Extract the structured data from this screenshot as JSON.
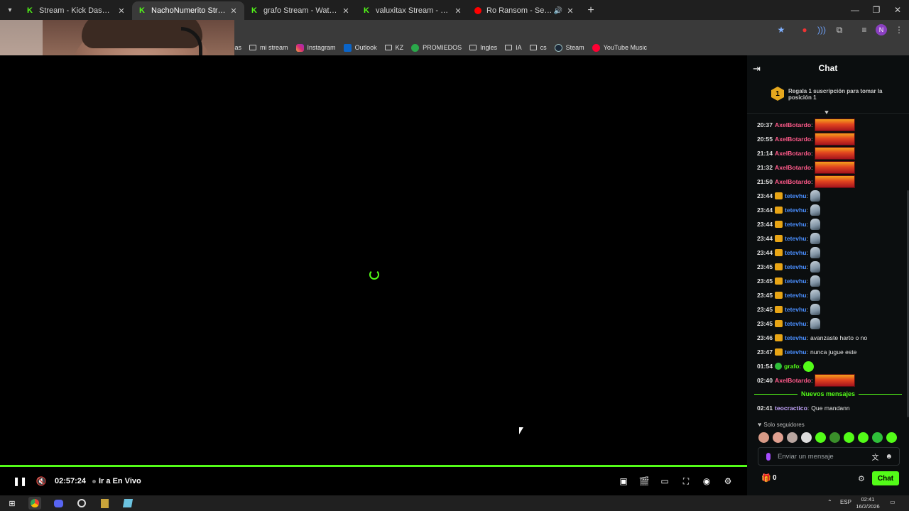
{
  "tabs": [
    {
      "label": "Stream - Kick Dashboard",
      "favicon": "kick-icon",
      "active": false
    },
    {
      "label": "NachoNumerito Stream - Watch",
      "favicon": "kick-icon",
      "active": true
    },
    {
      "label": "grafo Stream - Watch Live on K",
      "favicon": "kick-icon",
      "active": false
    },
    {
      "label": "valuxitax Stream - Watch Live o",
      "favicon": "kick-icon",
      "active": false
    },
    {
      "label": "Ro Ransom - See Me Fall ft",
      "favicon": "youtube-icon",
      "active": false
    }
  ],
  "bookmarks": [
    {
      "label": "cas",
      "icon": "folder-icon"
    },
    {
      "label": "mi stream",
      "icon": "folder-icon"
    },
    {
      "label": "Instagram",
      "icon": "instagram-icon"
    },
    {
      "label": "Outlook",
      "icon": "outlook-icon"
    },
    {
      "label": "KZ",
      "icon": "folder-icon"
    },
    {
      "label": "PROMIEDOS",
      "icon": "promiedos-icon"
    },
    {
      "label": "Ingles",
      "icon": "folder-icon"
    },
    {
      "label": "IA",
      "icon": "folder-icon"
    },
    {
      "label": "cs",
      "icon": "folder-icon"
    },
    {
      "label": "Steam",
      "icon": "steam-icon"
    },
    {
      "label": "YouTube Music",
      "icon": "youtube-music-icon"
    }
  ],
  "player": {
    "time": "02:57:24",
    "live_label": "Ir a En Vivo"
  },
  "chat": {
    "title": "Chat",
    "pinned_rank": "1",
    "pinned_text": "Regala 1 suscripción para tomar la posición 1",
    "messages": [
      {
        "time": "20:37",
        "user": "AxelBotardo",
        "color": "#ff5a8a",
        "badge": "none",
        "content": "",
        "emote": "fire"
      },
      {
        "time": "20:55",
        "user": "AxelBotardo",
        "color": "#ff5a8a",
        "badge": "none",
        "content": "",
        "emote": "fire"
      },
      {
        "time": "21:14",
        "user": "AxelBotardo",
        "color": "#ff5a8a",
        "badge": "none",
        "content": "",
        "emote": "fire"
      },
      {
        "time": "21:32",
        "user": "AxelBotardo",
        "color": "#ff5a8a",
        "badge": "none",
        "content": "",
        "emote": "fire"
      },
      {
        "time": "21:50",
        "user": "AxelBotardo",
        "color": "#ff5a8a",
        "badge": "none",
        "content": "",
        "emote": "fire"
      },
      {
        "time": "23:44",
        "user": "tetevhu",
        "color": "#4a8fff",
        "badge": "crown",
        "content": "",
        "emote": "bird"
      },
      {
        "time": "23:44",
        "user": "tetevhu",
        "color": "#4a8fff",
        "badge": "crown",
        "content": "",
        "emote": "bird"
      },
      {
        "time": "23:44",
        "user": "tetevhu",
        "color": "#4a8fff",
        "badge": "crown",
        "content": "",
        "emote": "bird"
      },
      {
        "time": "23:44",
        "user": "tetevhu",
        "color": "#4a8fff",
        "badge": "crown",
        "content": "",
        "emote": "bird"
      },
      {
        "time": "23:44",
        "user": "tetevhu",
        "color": "#4a8fff",
        "badge": "crown",
        "content": "",
        "emote": "bird"
      },
      {
        "time": "23:45",
        "user": "tetevhu",
        "color": "#4a8fff",
        "badge": "crown",
        "content": "",
        "emote": "bird"
      },
      {
        "time": "23:45",
        "user": "tetevhu",
        "color": "#4a8fff",
        "badge": "crown",
        "content": "",
        "emote": "bird"
      },
      {
        "time": "23:45",
        "user": "tetevhu",
        "color": "#4a8fff",
        "badge": "crown",
        "content": "",
        "emote": "bird"
      },
      {
        "time": "23:45",
        "user": "tetevhu",
        "color": "#4a8fff",
        "badge": "crown",
        "content": "",
        "emote": "bird"
      },
      {
        "time": "23:45",
        "user": "tetevhu",
        "color": "#4a8fff",
        "badge": "crown",
        "content": "",
        "emote": "bird"
      },
      {
        "time": "23:46",
        "user": "tetevhu",
        "color": "#4a8fff",
        "badge": "crown",
        "content": "avanzaste harto o no",
        "emote": "none"
      },
      {
        "time": "23:47",
        "user": "tetevhu",
        "color": "#4a8fff",
        "badge": "crown",
        "content": "nunca jugue este",
        "emote": "none"
      },
      {
        "time": "01:54",
        "user": "grafo",
        "color": "#53fc18",
        "badge": "verified",
        "content": "",
        "emote": "kick"
      },
      {
        "time": "02:40",
        "user": "AxelBotardo",
        "color": "#ff5a8a",
        "badge": "none",
        "content": "",
        "emote": "fire"
      }
    ],
    "new_messages_label": "Nuevos mensajes",
    "last_message": {
      "time": "02:41",
      "user": "teocractico",
      "color": "#c6a6ff",
      "content": "Que mandann"
    },
    "followers_only": "Solo seguidores",
    "input_placeholder": "Enviar un mensaje",
    "gift_count": "0",
    "chat_button": "Chat"
  },
  "taskbar": {
    "language": "ESP",
    "time": "02:41",
    "date": "16/2/2026"
  },
  "colors": {
    "accent": "#53fc18",
    "chat_bg": "#0b0e0f",
    "browser_bg": "#3a3a3a"
  }
}
